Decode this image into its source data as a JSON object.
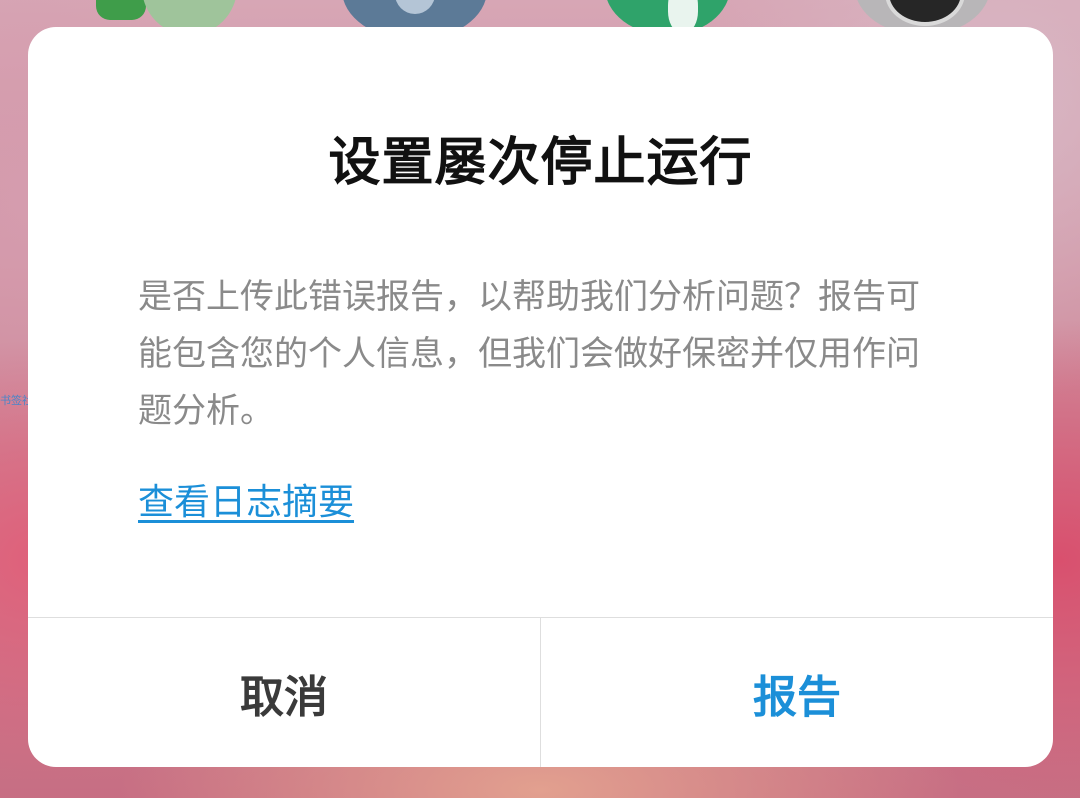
{
  "background": {
    "side_label": "书签社区"
  },
  "dialog": {
    "title": "设置屡次停止运行",
    "message": "是否上传此错误报告，以帮助我们分析问题？报告可能包含您的个人信息，但我们会做好保密并仅用作问题分析。",
    "log_link_label": "查看日志摘要",
    "cancel_label": "取消",
    "confirm_label": "报告"
  },
  "colors": {
    "accent": "#1b8fd8",
    "title_text": "#111111",
    "body_text": "#8a8a8a",
    "cancel_text": "#3a3a3a"
  }
}
